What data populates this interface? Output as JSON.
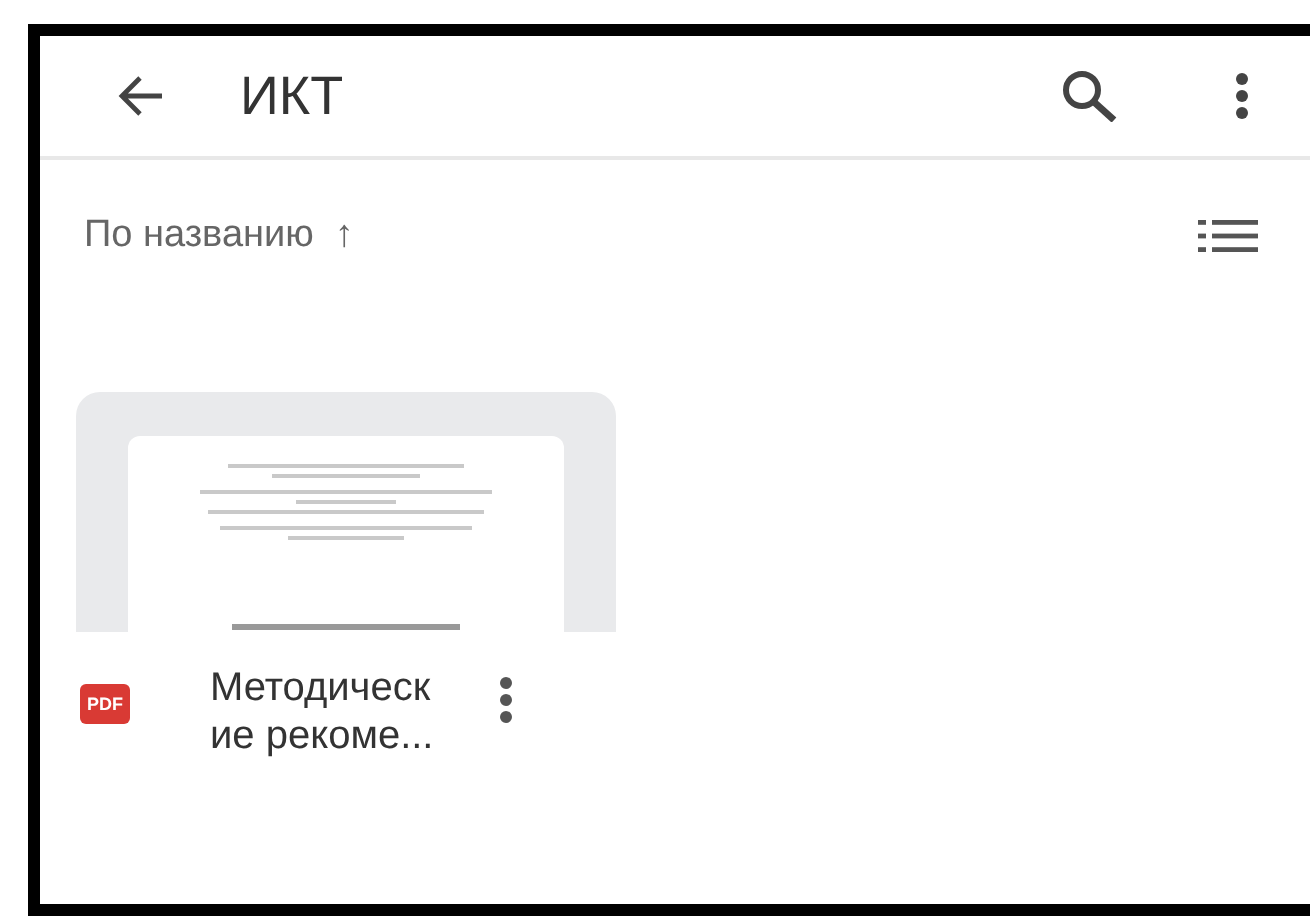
{
  "toolbar": {
    "title": "ИКТ"
  },
  "sort": {
    "label": "По названию",
    "arrow": "↑"
  },
  "files": [
    {
      "name": "Методические рекоме...",
      "kind": "pdf",
      "type_label": "PDF"
    }
  ]
}
